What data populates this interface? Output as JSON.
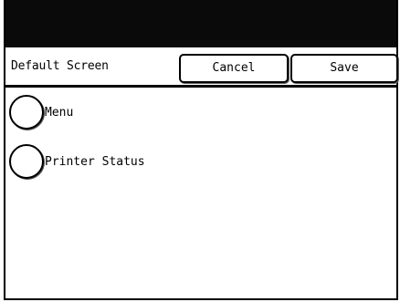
{
  "header": {
    "screen_label": "Default Screen",
    "cancel_label": "Cancel",
    "save_label": "Save"
  },
  "options": [
    {
      "label": "Menu",
      "selected": false
    },
    {
      "label": "Printer Status",
      "selected": false
    }
  ],
  "colors": {
    "title_bar": "#0a0a0a",
    "background": "#ffffff",
    "border": "#000000"
  }
}
